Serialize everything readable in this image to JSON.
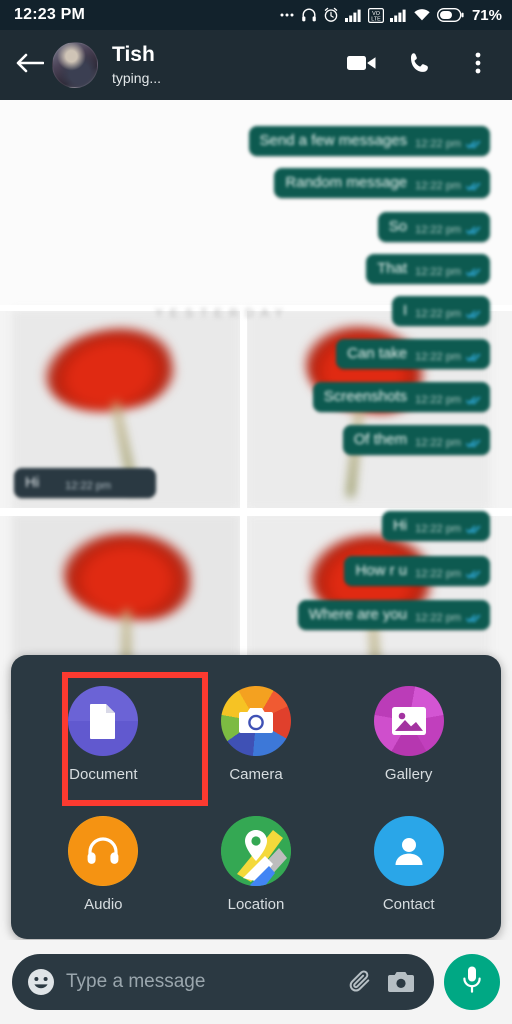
{
  "status_bar": {
    "time": "12:23 PM",
    "battery_percent": "71%",
    "icons": [
      "ellipsis-icon",
      "headphones-icon",
      "alarm-icon",
      "signal-icon",
      "volte-icon",
      "signal-icon",
      "wifi-icon",
      "battery-icon"
    ],
    "volte_label_top": "VO",
    "volte_label_bottom": "LTE"
  },
  "app_bar": {
    "back_icon": "back-arrow-icon",
    "contact_name": "Tish",
    "contact_status": "typing...",
    "video_call_icon": "video-call-icon",
    "voice_call_icon": "phone-call-icon",
    "overflow_icon": "overflow-menu-icon"
  },
  "chat": {
    "date_divider": "YESTERDAY",
    "messages": [
      {
        "text": "Send a few messages",
        "time": "12:22 pm",
        "direction": "out",
        "status": "read"
      },
      {
        "text": "Random message",
        "time": "12:22 pm",
        "direction": "out",
        "status": "read"
      },
      {
        "text": "So",
        "time": "12:22 pm",
        "direction": "out",
        "status": "read"
      },
      {
        "text": "That",
        "time": "12:22 pm",
        "direction": "out",
        "status": "read"
      },
      {
        "text": "I",
        "time": "12:22 pm",
        "direction": "out",
        "status": "read"
      },
      {
        "text": "Can take",
        "time": "12:22 pm",
        "direction": "out",
        "status": "read"
      },
      {
        "text": "Screenshots",
        "time": "12:22 pm",
        "direction": "out",
        "status": "read"
      },
      {
        "text": "Of them",
        "time": "12:22 pm",
        "direction": "out",
        "status": "read"
      },
      {
        "text": "Hi",
        "time": "12:22 pm",
        "direction": "in",
        "status": ""
      },
      {
        "text": "Hi",
        "time": "12:22 pm",
        "direction": "out",
        "status": "read"
      },
      {
        "text": "How r u",
        "time": "12:22 pm",
        "direction": "out",
        "status": "read"
      },
      {
        "text": "Where are you",
        "time": "12:22 pm",
        "direction": "out",
        "status": "read"
      }
    ]
  },
  "attach_panel": {
    "items": [
      {
        "label": "Document",
        "icon": "document-icon",
        "highlighted": true
      },
      {
        "label": "Camera",
        "icon": "camera-icon",
        "highlighted": false
      },
      {
        "label": "Gallery",
        "icon": "gallery-icon",
        "highlighted": false
      },
      {
        "label": "Audio",
        "icon": "audio-icon",
        "highlighted": false
      },
      {
        "label": "Location",
        "icon": "location-icon",
        "highlighted": false
      },
      {
        "label": "Contact",
        "icon": "contact-icon",
        "highlighted": false
      }
    ],
    "highlight_color": "#fc3a30"
  },
  "input_bar": {
    "emoji_icon": "emoji-icon",
    "placeholder": "Type a message",
    "value": "",
    "attach_icon": "paperclip-icon",
    "camera_icon": "camera-icon",
    "mic_icon": "microphone-icon",
    "mic_color": "#00a884"
  }
}
